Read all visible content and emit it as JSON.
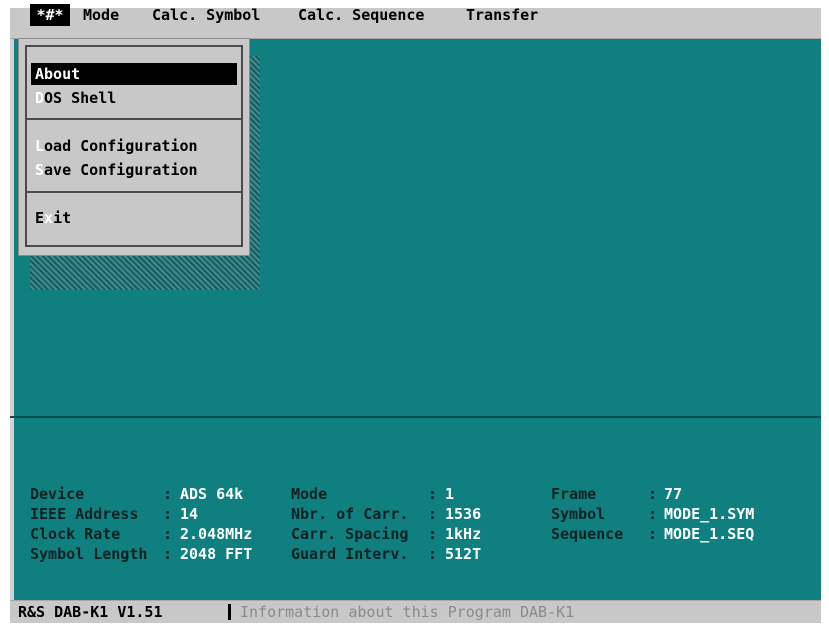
{
  "menubar": {
    "system_label": "*#*",
    "items": [
      {
        "label": "Mode"
      },
      {
        "label": "Calc. Symbol"
      },
      {
        "label": "Calc. Sequence"
      },
      {
        "label": "Transfer"
      }
    ]
  },
  "dropdown": {
    "items": [
      {
        "hotkey": "A",
        "rest": "bout",
        "selected": true
      },
      {
        "hotkey": "D",
        "rest": "OS Shell"
      },
      {
        "hotkey": "L",
        "rest": "oad Configuration"
      },
      {
        "hotkey": "S",
        "rest": "ave Configuration"
      },
      {
        "prefix": "E",
        "hotkey": "x",
        "rest": "it"
      }
    ]
  },
  "info": {
    "device_label": "Device",
    "device_value": "ADS 64k",
    "ieee_label": "IEEE Address",
    "ieee_value": "14",
    "clock_label": "Clock Rate",
    "clock_value": "2.048MHz",
    "symlen_label": "Symbol Length",
    "symlen_value": "2048 FFT",
    "mode_label": "Mode",
    "mode_value": "1",
    "carr_label": "Nbr. of Carr.",
    "carr_value": "1536",
    "spacing_label": "Carr. Spacing",
    "spacing_value": "1kHz",
    "guard_label": "Guard Interv.",
    "guard_value": "512T",
    "frame_label": "Frame",
    "frame_value": "77",
    "symbol_label": "Symbol",
    "symbol_value": "MODE_1.SYM",
    "sequence_label": "Sequence",
    "sequence_value": "MODE_1.SEQ",
    "colon": ":"
  },
  "status": {
    "app": "R&S DAB-K1 V1.51",
    "hint": "Information about this Program DAB-K1"
  },
  "colors": {
    "background": "#0f7f80",
    "menu": "#c8c8c8",
    "label_text": "#0b2122",
    "value_text": "#ffffff"
  }
}
